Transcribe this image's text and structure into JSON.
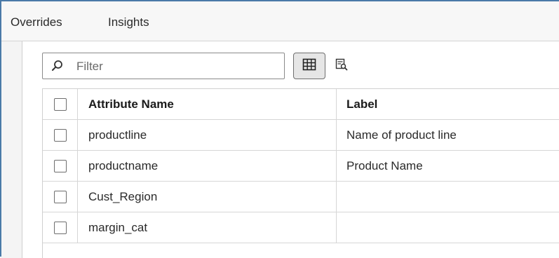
{
  "tabs": [
    {
      "label": "Overrides"
    },
    {
      "label": "Insights"
    }
  ],
  "filter": {
    "placeholder": "Filter",
    "value": ""
  },
  "icons": {
    "filter": "search-icon",
    "grid_view": "grid-view-icon",
    "detail_view": "detail-view-icon"
  },
  "table": {
    "columns": [
      {
        "label": "Attribute Name"
      },
      {
        "label": "Label"
      }
    ],
    "rows": [
      {
        "name": "productline",
        "label": "Name of product line"
      },
      {
        "name": "productname",
        "label": "Product Name"
      },
      {
        "name": "Cust_Region",
        "label": ""
      },
      {
        "name": "margin_cat",
        "label": ""
      }
    ]
  },
  "colors": {
    "frame_border": "#4a7aa8",
    "active_view_bg": "#e6e6e6"
  }
}
